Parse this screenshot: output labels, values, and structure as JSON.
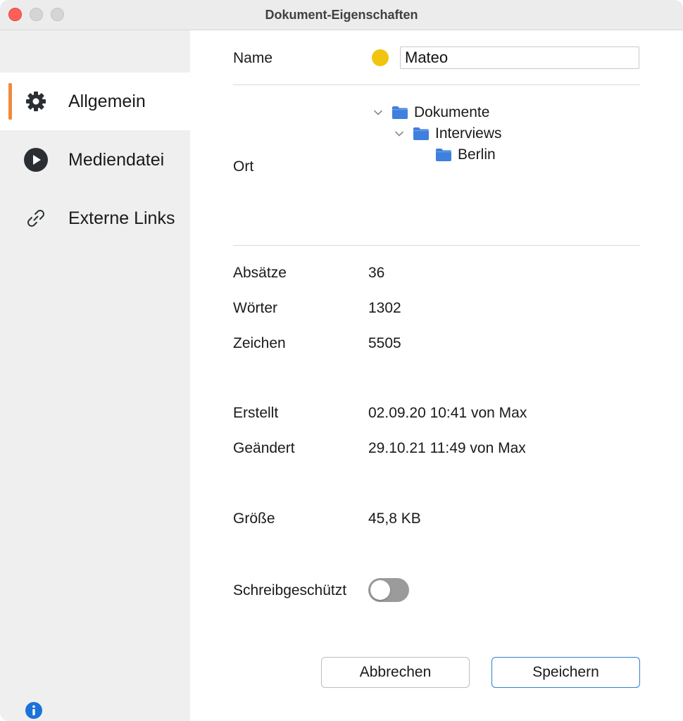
{
  "window": {
    "title": "Dokument-Eigenschaften"
  },
  "sidebar": {
    "items": [
      {
        "label": "Allgemein",
        "icon": "gear-icon",
        "active": true
      },
      {
        "label": "Mediendatei",
        "icon": "play-icon",
        "active": false
      },
      {
        "label": "Externe Links",
        "icon": "link-icon",
        "active": false
      }
    ],
    "accent_color": "#f08a3c",
    "info_icon": "info-icon"
  },
  "general": {
    "name_label": "Name",
    "name_value": "Mateo",
    "name_color": "#f1c40f",
    "location_label": "Ort",
    "tree": [
      {
        "label": "Dokumente",
        "expanded": true
      },
      {
        "label": "Interviews",
        "expanded": true
      },
      {
        "label": "Berlin",
        "expanded": false
      }
    ],
    "stats": {
      "paragraphs_label": "Absätze",
      "paragraphs_value": "36",
      "words_label": "Wörter",
      "words_value": "1302",
      "chars_label": "Zeichen",
      "chars_value": "5505"
    },
    "created_label": "Erstellt",
    "created_value": "02.09.20 10:41 von Max",
    "modified_label": "Geändert",
    "modified_value": "29.10.21 11:49 von Max",
    "size_label": "Größe",
    "size_value": "45,8 KB",
    "readonly_label": "Schreibgeschützt",
    "readonly_on": false
  },
  "buttons": {
    "cancel_label": "Abbrechen",
    "save_label": "Speichern",
    "save_border_color": "#2f7fd3"
  }
}
